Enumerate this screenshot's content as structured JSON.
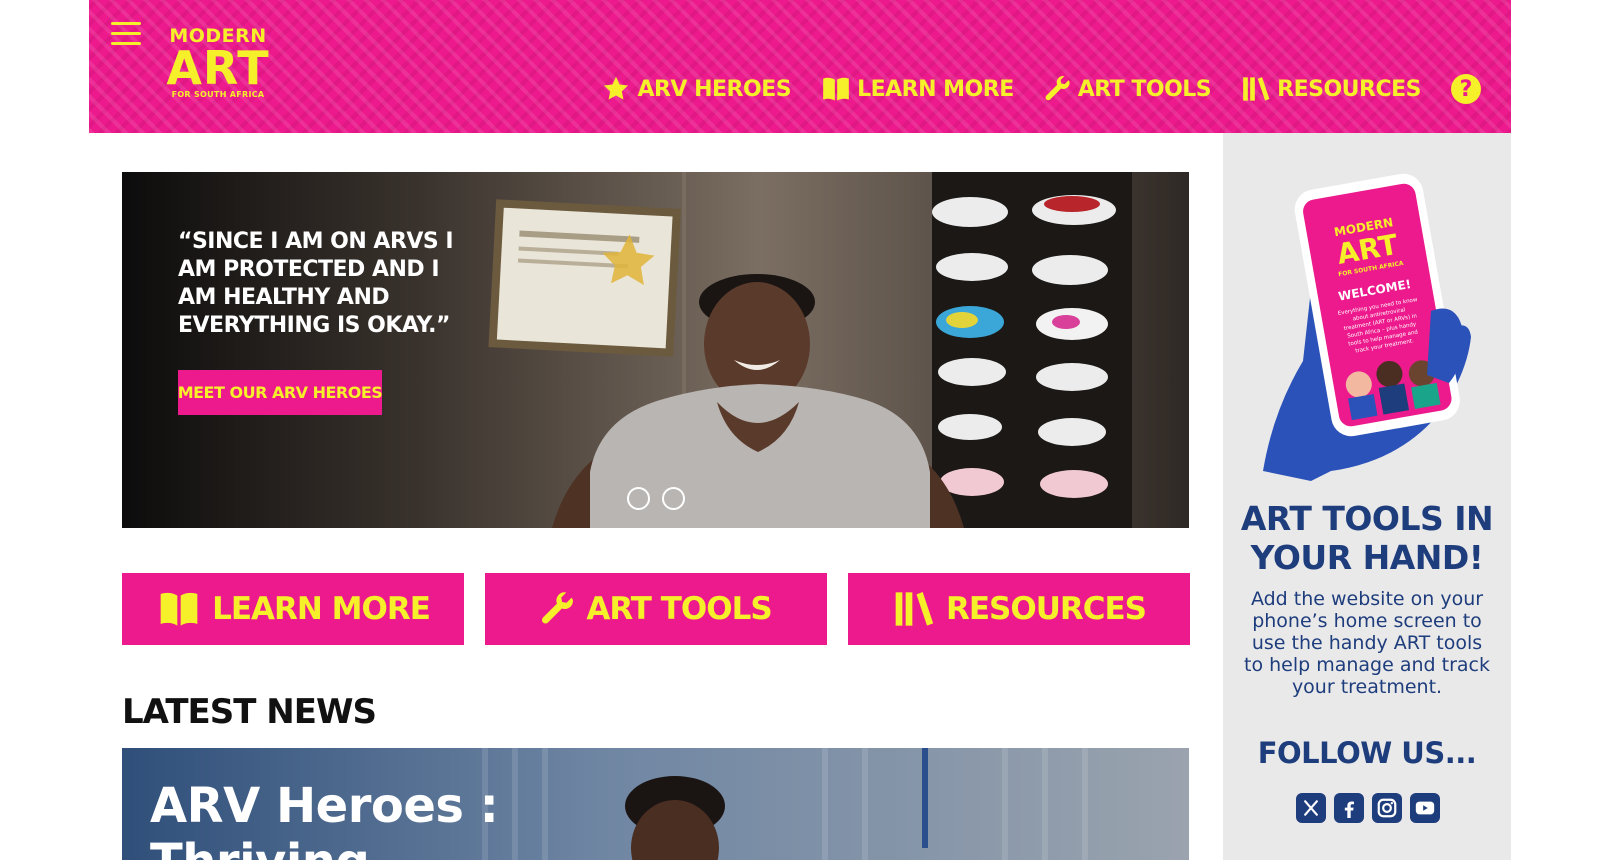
{
  "header": {
    "logo": {
      "top": "MODERN",
      "main": "ART",
      "sub": "FOR SOUTH AFRICA"
    },
    "nav": [
      {
        "label": "ARV HEROES",
        "icon": "star-icon"
      },
      {
        "label": "LEARN MORE",
        "icon": "book-icon"
      },
      {
        "label": "ART TOOLS",
        "icon": "wrench-icon"
      },
      {
        "label": "RESOURCES",
        "icon": "library-icon"
      }
    ],
    "help_glyph": "?"
  },
  "hero": {
    "quote": "“SINCE I AM ON ARVS I AM PROTECTED AND I AM HEALTHY AND EVERYTHING IS OKAY.”",
    "button_label": "MEET OUR ARV HEROES",
    "slide_count": 2
  },
  "actions": [
    {
      "label": "LEARN MORE",
      "icon": "book-icon"
    },
    {
      "label": "ART TOOLS",
      "icon": "wrench-icon"
    },
    {
      "label": "RESOURCES",
      "icon": "library-icon"
    }
  ],
  "news": {
    "title": "LATEST NEWS",
    "card_title": "ARV Heroes : Thriving"
  },
  "sidebar": {
    "phone": {
      "logo_top": "MODERN",
      "logo_main": "ART",
      "logo_sub": "FOR SOUTH AFRICA",
      "welcome": "WELCOME!",
      "lines": [
        "Everything you need to know",
        "about antiretroviral",
        "treatment (ART or ARVs) in",
        "South Africa – plus handy",
        "tools to help manage and",
        "track your treatment."
      ]
    },
    "title": "ART TOOLS IN YOUR HAND!",
    "text": "Add the website on your phone’s home screen to use the handy ART tools to help manage and track your treatment.",
    "follow_title": "FOLLOW US...",
    "social": [
      "x-icon",
      "facebook-icon",
      "instagram-icon",
      "youtube-icon"
    ]
  },
  "colors": {
    "brand_pink": "#ec1a8c",
    "brand_yellow": "#f5f02a",
    "navy": "#1e3d7c",
    "sidebar_bg": "#eae9ea"
  }
}
